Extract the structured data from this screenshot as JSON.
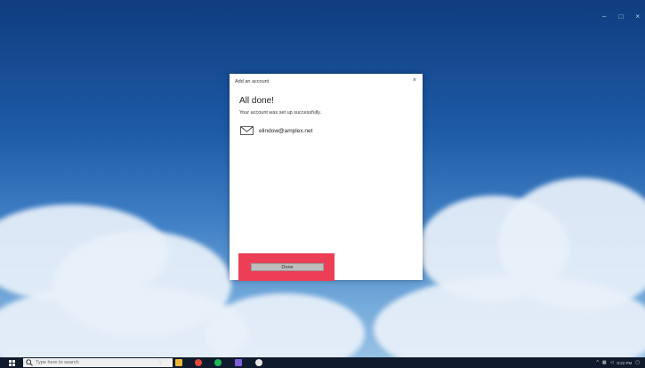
{
  "window_controls": {
    "minimize": "–",
    "maximize": "□",
    "close": "×"
  },
  "dialog": {
    "title": "Add an account",
    "close_glyph": "×",
    "heading": "All done!",
    "subheading": "Your account was set up successfully.",
    "account_email": "elindow@amplex.net",
    "done_label": "Done"
  },
  "taskbar": {
    "search_placeholder": "Type here to search",
    "time": "5:22 PM",
    "icons": [
      "windows-start-icon",
      "search-icon",
      "microphone-icon",
      "file-explorer-icon",
      "chrome-icon",
      "spotify-icon",
      "visual-studio-icon",
      "unity-icon",
      "action-center-icon"
    ]
  },
  "colors": {
    "highlight": "#ec3f55",
    "taskbar": "#0f1b2c",
    "button": "#bdbdbd"
  }
}
